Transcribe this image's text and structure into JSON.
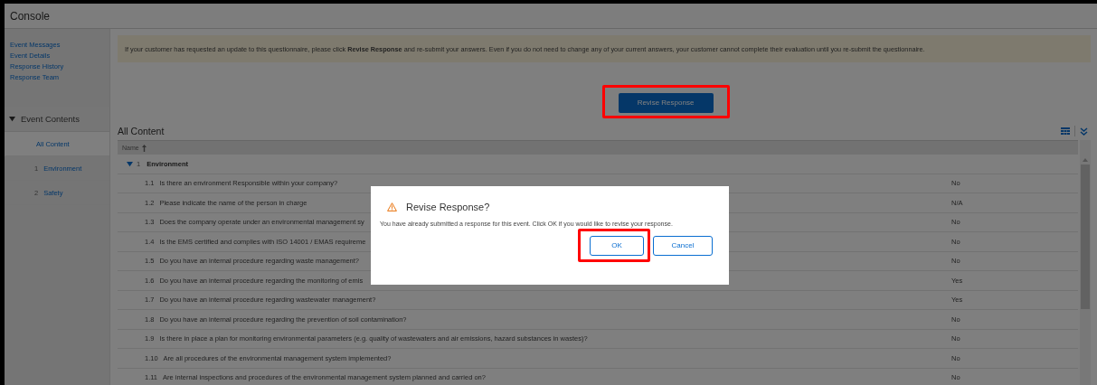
{
  "header": {
    "title": "Console"
  },
  "sidebar": {
    "links": [
      "Event Messages",
      "Event Details",
      "Response History",
      "Response Team"
    ],
    "section": {
      "title": "Event Contents",
      "expanded": true
    },
    "items": [
      {
        "label": "All Content",
        "selected": true
      },
      {
        "number": "1",
        "label": "Environment",
        "selected": false
      },
      {
        "number": "2",
        "label": "Safety",
        "selected": false
      }
    ]
  },
  "banner": "If your customer has requested an update to this questionnaire, please click **Revise Response** and re-submit your answers. Even if you do not need to change any of your current answers, your customer cannot complete their evaluation until you re-submit the questionnaire.",
  "revise_button": {
    "label": "Revise Response",
    "highlighted": true
  },
  "content": {
    "title": "All Content",
    "column_1": "Name",
    "group": {
      "number": "1",
      "label": "Environment",
      "expanded": true
    },
    "rows": [
      {
        "number": "1.1",
        "question": "Is there an environment Responsible within your company?",
        "answer": "No"
      },
      {
        "number": "1.2",
        "question": "Please indicate the name of the person in charge",
        "answer": "N/A"
      },
      {
        "number": "1.3",
        "question": "Does the company operate under an environmental management sy",
        "answer": "No"
      },
      {
        "number": "1.4",
        "question": "Is the EMS certified and complies with ISO 14001 / EMAS requireme",
        "answer": "No"
      },
      {
        "number": "1.5",
        "question": "Do you have an internal procedure regarding waste management?",
        "answer": "No"
      },
      {
        "number": "1.6",
        "question": "Do you have an internal procedure regarding the monitoring of emis",
        "answer": "Yes"
      },
      {
        "number": "1.7",
        "question": "Do you have an internal procedure regarding wastewater management?",
        "answer": "Yes"
      },
      {
        "number": "1.8",
        "question": "Do you have an internal procedure regarding the prevention of soil contamination?",
        "answer": "No"
      },
      {
        "number": "1.9",
        "question": "Is there in place a plan for monitoring environmental parameters (e.g. quality of wastewaters and air emissions, hazard substances in wastes)?",
        "answer": "No"
      },
      {
        "number": "1.10",
        "question": "Are all procedures of the environmental management system implemented?",
        "answer": "No"
      },
      {
        "number": "1.11",
        "question": "Are internal inspections and procedures of the environmental management system planned and carried on?",
        "answer": "No"
      }
    ]
  },
  "dialog": {
    "title": "Revise Response?",
    "message": "You have already submitted a response for this event. Click OK if you would like to revise your response.",
    "buttons": [
      {
        "label": "OK",
        "highlighted": true
      },
      {
        "label": "Cancel",
        "highlighted": false
      }
    ]
  }
}
